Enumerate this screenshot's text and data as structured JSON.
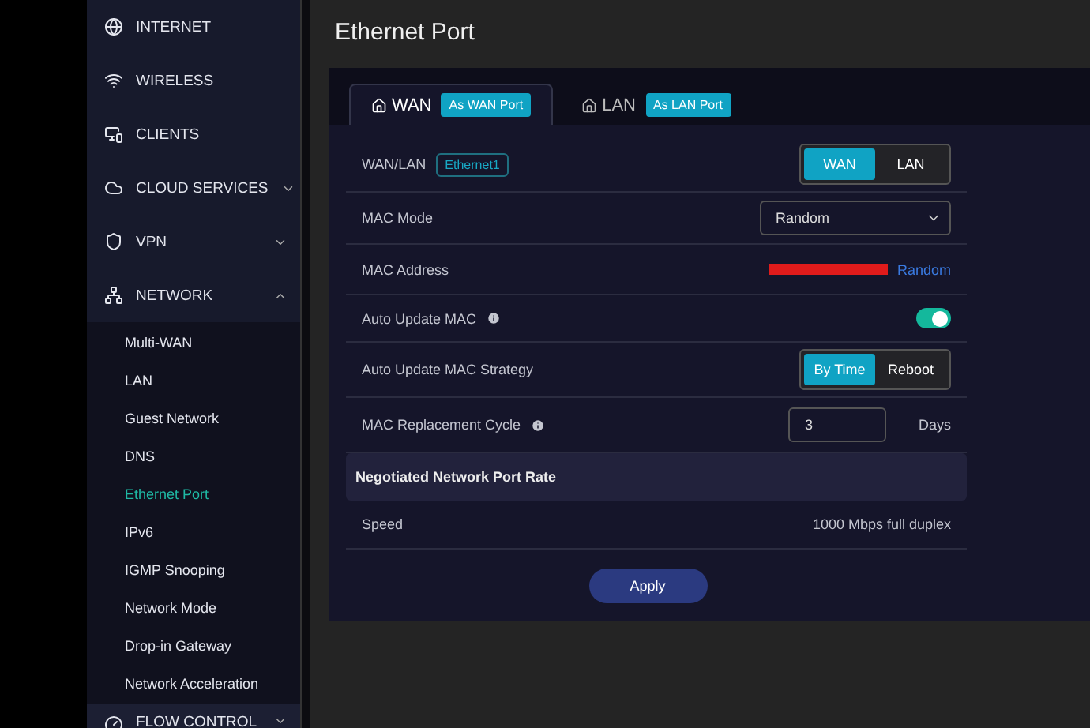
{
  "sidebar": {
    "items": [
      {
        "label": "INTERNET"
      },
      {
        "label": "WIRELESS"
      },
      {
        "label": "CLIENTS"
      },
      {
        "label": "CLOUD SERVICES",
        "expanded": false
      },
      {
        "label": "VPN",
        "expanded": false
      },
      {
        "label": "NETWORK",
        "expanded": true,
        "children": [
          {
            "label": "Multi-WAN",
            "selected": false
          },
          {
            "label": "LAN",
            "selected": false
          },
          {
            "label": "Guest Network",
            "selected": false
          },
          {
            "label": "DNS",
            "selected": false
          },
          {
            "label": "Ethernet Port",
            "selected": true
          },
          {
            "label": "IPv6",
            "selected": false
          },
          {
            "label": "IGMP Snooping",
            "selected": false
          },
          {
            "label": "Network Mode",
            "selected": false
          },
          {
            "label": "Drop-in Gateway",
            "selected": false
          },
          {
            "label": "Network Acceleration",
            "selected": false
          }
        ]
      },
      {
        "label": "FLOW CONTROL",
        "expanded": false
      }
    ]
  },
  "page": {
    "title": "Ethernet Port"
  },
  "tabs": [
    {
      "label": "WAN",
      "badge": "As WAN Port",
      "selected": true
    },
    {
      "label": "LAN",
      "badge": "As LAN Port",
      "selected": false
    }
  ],
  "rows": [
    {
      "kind": "segment",
      "label": "WAN/LAN",
      "tag": "Ethernet1",
      "options": [
        {
          "label": "WAN",
          "selected": true
        },
        {
          "label": "LAN",
          "selected": false
        }
      ]
    },
    {
      "kind": "select",
      "label": "MAC Mode",
      "value": "Random"
    },
    {
      "kind": "mac",
      "label": "MAC Address",
      "link": "Random"
    },
    {
      "kind": "toggle",
      "label": "Auto Update MAC",
      "info": true,
      "on": true
    },
    {
      "kind": "segment",
      "label": "Auto Update MAC Strategy",
      "options": [
        {
          "label": "By Time",
          "selected": true
        },
        {
          "label": "Reboot",
          "selected": false
        }
      ]
    },
    {
      "kind": "number",
      "label": "MAC Replacement Cycle",
      "info": true,
      "value": "3",
      "unit": "Days"
    }
  ],
  "section": {
    "title": "Negotiated Network Port Rate",
    "rows": [
      {
        "label": "Speed",
        "value": "1000 Mbps full duplex"
      }
    ]
  },
  "apply_button": "Apply"
}
